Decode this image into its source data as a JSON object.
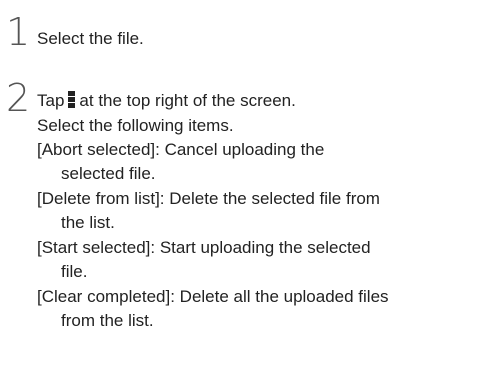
{
  "steps": [
    {
      "number": "1",
      "text": "Select the file."
    },
    {
      "number": "2",
      "text_before_icon": "Tap",
      "icon": "vertical-menu-icon",
      "text_after_icon": "at the top right of the screen.",
      "subtext": "Select the following items.",
      "items": [
        {
          "line1": "[Abort selected]: Cancel uploading the",
          "line2": "selected file."
        },
        {
          "line1": "[Delete from list]: Delete the selected file from",
          "line2": "the list."
        },
        {
          "line1": "[Start selected]: Start uploading the selected",
          "line2": "file."
        },
        {
          "line1": "[Clear completed]: Delete all the uploaded files",
          "line2": "from the list."
        }
      ]
    }
  ]
}
